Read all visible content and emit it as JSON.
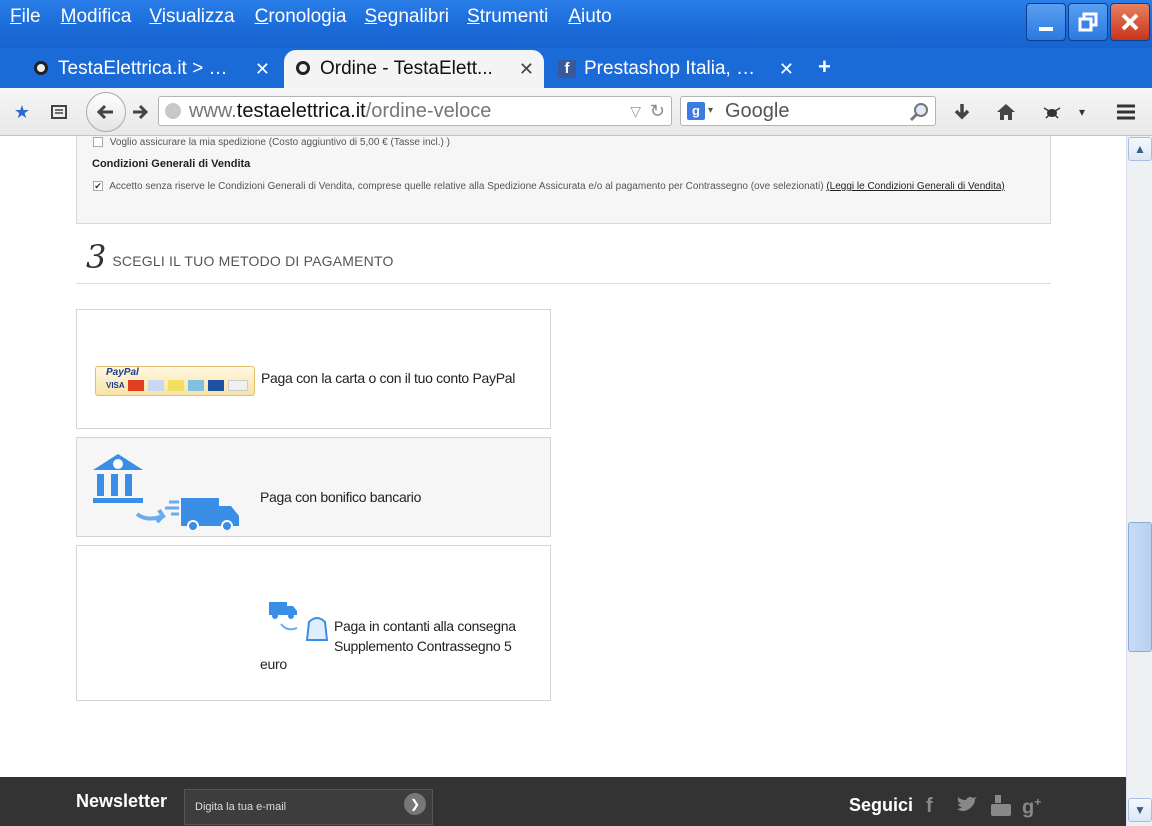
{
  "menu": {
    "items": [
      "File",
      "Modifica",
      "Visualizza",
      "Cronologia",
      "Segnalibri",
      "Strumenti",
      "Aiuto"
    ]
  },
  "tabs": [
    {
      "label": "TestaElettrica.it > …",
      "active": false
    },
    {
      "label": "Ordine - TestaElett...",
      "active": true
    },
    {
      "label": "Prestashop Italia, …",
      "active": false
    }
  ],
  "toolbar": {
    "url_prefix": "www.",
    "url_domain": "testaelettrica.it",
    "url_path": "/ordine-veloce",
    "search_placeholder": "Google"
  },
  "shipping": {
    "insurance_label": "Voglio assicurare la mia spedizione  (Costo aggiuntivo di 5,00 € (Tasse incl.) )",
    "terms_heading": "Condizioni Generali di Vendita",
    "terms_label": "Accetto senza riserve le Condizioni Generali di Vendita, comprese quelle relative alla Spedizione Assicurata e/o al pagamento per Contrassegno (ove selezionati)",
    "terms_link": "(Leggi le Condizioni Generali di Vendita)"
  },
  "payment": {
    "step_number": "3",
    "step_title": "SCEGLI IL TUO METODO DI PAGAMENTO",
    "methods": [
      {
        "label": "Paga con la carta o con il tuo conto PayPal",
        "icon": "paypal-cards-icon"
      },
      {
        "label": "Paga con bonifico bancario",
        "icon": "bank-transfer-icon"
      },
      {
        "label": "Paga in contanti alla consegna",
        "label2": "Supplemento Contrassegno 5",
        "label3": "euro",
        "icon": "cash-on-delivery-icon"
      }
    ],
    "paypal_logo_text": "PayPal",
    "card_labels": [
      "VISA"
    ]
  },
  "footer": {
    "newsletter_title": "Newsletter",
    "newsletter_placeholder": "Digita la tua e-mail",
    "follow_label": "Seguici"
  },
  "colors": {
    "titlebar": "#1a6ad8",
    "footer": "#333333",
    "accent_blue": "#3a8ee6"
  }
}
